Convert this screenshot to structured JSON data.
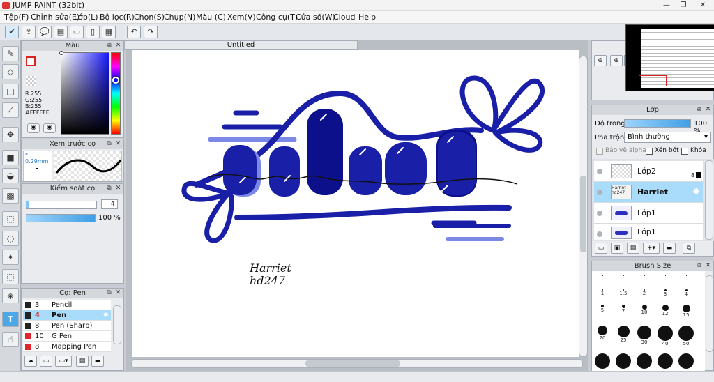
{
  "window": {
    "title": "JUMP PAINT (32bit)",
    "minimize": "—",
    "restore": "❐",
    "close": "✕"
  },
  "menu": [
    "Tệp(F)",
    "Chỉnh sửa(E)",
    "Lớp(L)",
    "Bộ lọc(R)",
    "Chọn(S)",
    "Chụp(N)",
    "Màu (C)",
    "Xem(V)",
    "Công cụ(T)",
    "Cửa sổ(W)",
    "Cloud",
    "Help"
  ],
  "document": {
    "tab_title": "Untitled"
  },
  "color_panel": {
    "title": "Màu",
    "r": "R:255",
    "g": "G:255",
    "b": "B:255",
    "hex": "#FFFFFF"
  },
  "preview_panel": {
    "title": "Xem trước cọ",
    "size": "* 0.29mm"
  },
  "brush_control": {
    "title": "Kiểm soát cọ",
    "size": "4",
    "opacity": "100 %"
  },
  "brush_list": {
    "title": "Cọ: Pen",
    "items": [
      {
        "size": "3",
        "name": "Pencil",
        "color": "#222222",
        "selected": false
      },
      {
        "size": "4",
        "name": "Pen",
        "color": "#222222",
        "selected": true
      },
      {
        "size": "8",
        "name": "Pen (Sharp)",
        "color": "#222222",
        "selected": false
      },
      {
        "size": "10",
        "name": "G Pen",
        "color": "#e0262b",
        "selected": false
      },
      {
        "size": "8",
        "name": "Mapping Pen",
        "color": "#e0262b",
        "selected": false
      }
    ]
  },
  "layers_panel": {
    "title": "Lớp",
    "opacity_label": "Độ trong",
    "opacity_value": "100 %",
    "blend_label": "Pha trộn",
    "blend_value": "Bình thường",
    "protect_alpha": "Bảo vệ alpha",
    "clipping": "Xén bớt",
    "lock": "Khóa",
    "layers": [
      {
        "name": "Lớp2",
        "badge": "8",
        "selected": false
      },
      {
        "name": "Harriet",
        "thumb_text": "Harriet hd247",
        "selected": true
      },
      {
        "name": "Lớp1",
        "selected": false
      },
      {
        "name": "Lớp1",
        "selected": false
      }
    ]
  },
  "brush_size_panel": {
    "title": "Brush Size",
    "rows": [
      [
        "",
        "",
        "",
        "",
        ""
      ],
      [
        "1",
        "1.5",
        "2",
        "3",
        "4"
      ],
      [
        "5",
        "7",
        "10",
        "12",
        "15"
      ],
      [
        "20",
        "25",
        "30",
        "40",
        "50"
      ],
      [
        "",
        "",
        "",
        "",
        ""
      ]
    ]
  },
  "artwork": {
    "word": "what",
    "signature_line1": "Harriet",
    "signature_line2": "hd247",
    "colors": {
      "primary": "#1a1fa8",
      "light": "#7c88e6",
      "dark": "#0c108a",
      "script": "#111111"
    }
  },
  "accent": "#4aa8e8"
}
